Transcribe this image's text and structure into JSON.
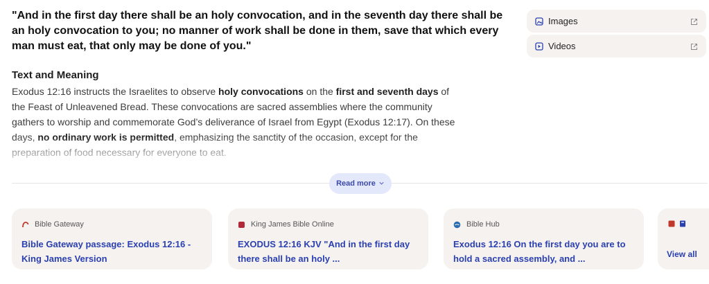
{
  "quote": "\"And in the first day there shall be an holy convocation, and in the seventh day there shall be an holy convocation to you; no manner of work shall be done in them, save that which every man must eat, that only may be done of you.\"",
  "section": {
    "title": "Text and Meaning",
    "parts": [
      {
        "text": "Exodus 12:16 instructs the Israelites to observe ",
        "bold": false
      },
      {
        "text": "holy convocations",
        "bold": true
      },
      {
        "text": " on the ",
        "bold": false
      },
      {
        "text": "first and seventh days",
        "bold": true
      },
      {
        "text": " of the Feast of Unleavened Bread. These convocations are sacred assemblies where the community gathers to worship and commemorate God’s deliverance of Israel from Egypt (Exodus 12:17). On these days, ",
        "bold": false
      },
      {
        "text": "no ordinary work is permitted",
        "bold": true
      },
      {
        "text": ", emphasizing the sanctity of the occasion, except for the preparation of food necessary for everyone to eat.",
        "bold": false
      }
    ]
  },
  "read_more": {
    "label": "Read more",
    "icon": "chevron-down-icon"
  },
  "side": {
    "images_label": "Images",
    "videos_label": "Videos"
  },
  "cards": [
    {
      "source": "Bible Gateway",
      "title": "Bible Gateway passage: Exodus 12:16 - King James Version",
      "favicon_color": "#c0392b"
    },
    {
      "source": "King James Bible Online",
      "title": "EXODUS 12:16 KJV \"And in the first day there shall be an holy ...",
      "favicon_color": "#b22a3a"
    },
    {
      "source": "Bible Hub",
      "title": "Exodus 12:16 On the first day you are to hold a sacred assembly, and ...",
      "favicon_color": "#2b6cb0"
    }
  ],
  "view_all": {
    "label": "View all"
  },
  "colors": {
    "link": "#2a3fb0",
    "card_bg": "#f5f2ef",
    "pill_bg": "#e3e8fb"
  }
}
